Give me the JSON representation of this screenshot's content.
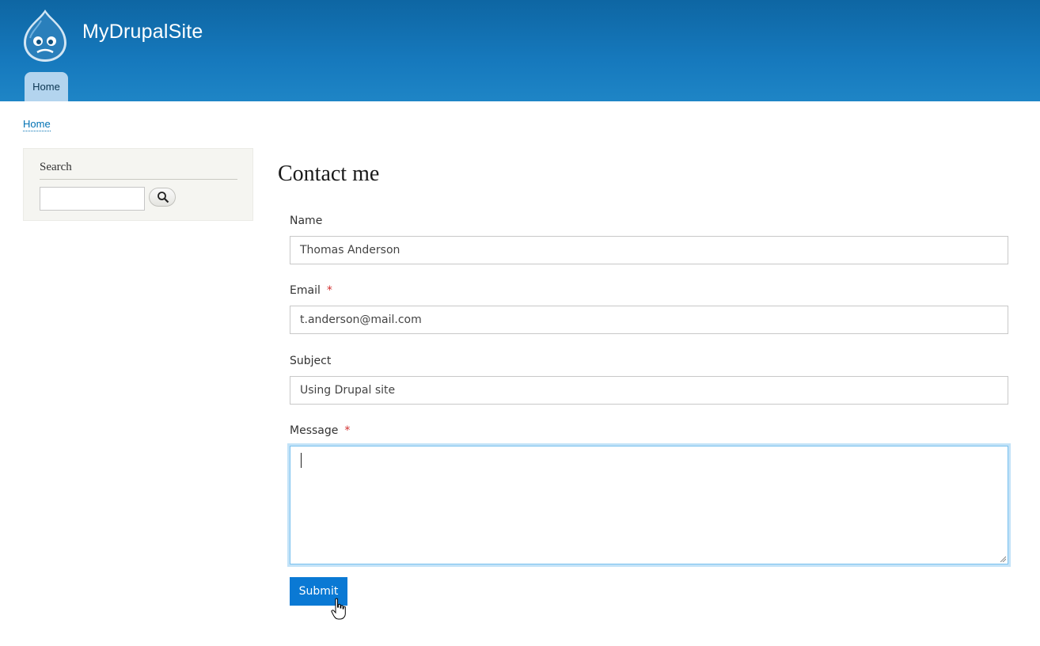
{
  "site": {
    "name": "MyDrupalSite",
    "logo_icon": "drupal-drop-icon"
  },
  "nav": {
    "tabs": [
      {
        "label": "Home"
      }
    ]
  },
  "breadcrumb": {
    "home": "Home"
  },
  "sidebar": {
    "search_title": "Search",
    "search_value": "",
    "search_button_icon": "search-icon"
  },
  "main": {
    "title": "Contact me",
    "form": {
      "name_label": "Name",
      "name_value": "Thomas Anderson",
      "email_label": "Email",
      "email_value": "t.anderson@mail.com",
      "subject_label": "Subject",
      "subject_value": "Using Drupal site",
      "message_label": "Message",
      "message_value": "",
      "required_marker": "*",
      "submit_label": "Submit"
    }
  },
  "colors": {
    "header": "#1679bd",
    "tab": "#b3d4ee",
    "accent": "#0a79d4",
    "required": "#d12f2f"
  }
}
